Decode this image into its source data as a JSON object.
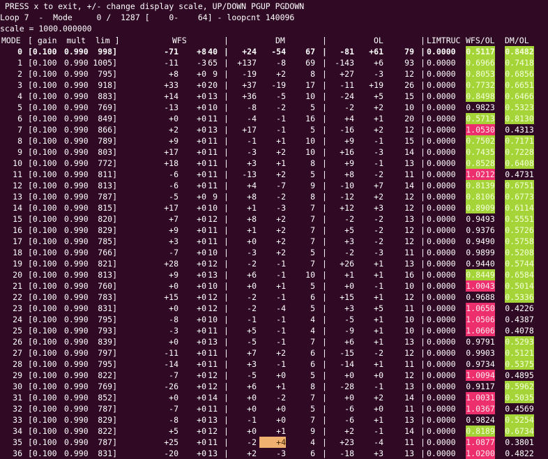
{
  "header": {
    "instructions": " PRESS x to exit, +/- change display scale, UP/DOWN PGUP PGDOWN",
    "status": "Loop 7  -  Mode     0 /  1287 [    0-    64] - loopcnt 140096",
    "scale": "scale = 1000.000000"
  },
  "columns": {
    "mode": "MODE",
    "gain_group": "[ gain  mult  lim ]",
    "wfs": "WFS",
    "dm": "DM",
    "ol": "OL",
    "limtruc": "LIMTRUC",
    "wfs_ol": "WFS/OL",
    "dm_ol": "DM/OL",
    "sep": "|"
  },
  "colors": {
    "background": "#300a24",
    "good": "#a4d438",
    "bad": "#ee2f6e",
    "warn": "#f0b070"
  },
  "rows": [
    {
      "mode": "0",
      "gain": "[0.100",
      "mult": "0.990",
      "lim": "998]",
      "wfs": [
        "-71",
        "+8",
        "40"
      ],
      "dm": [
        "+24",
        "-54",
        "67"
      ],
      "ol": [
        "-81",
        "+61",
        "79"
      ],
      "limtruc": "0.0000",
      "wfs_ol": "0.5117",
      "dm_ol": "0.8482",
      "wfs_hl": "g",
      "dm_hl": "g",
      "bold": true
    },
    {
      "mode": "1",
      "gain": "[0.100",
      "mult": "0.990",
      "lim": "1005]",
      "wfs": [
        "-11",
        "-3",
        "65"
      ],
      "dm": [
        "+137",
        "-8",
        "69"
      ],
      "ol": [
        "-143",
        "+6",
        "93"
      ],
      "limtruc": "0.0000",
      "wfs_ol": "0.6966",
      "dm_ol": "0.7418",
      "wfs_hl": "g",
      "dm_hl": "g"
    },
    {
      "mode": "2",
      "gain": "[0.100",
      "mult": "0.990",
      "lim": "795]",
      "wfs": [
        "+8",
        "+0",
        "9"
      ],
      "dm": [
        "-19",
        "+2",
        "8"
      ],
      "ol": [
        "+27",
        "-3",
        "12"
      ],
      "limtruc": "0.0000",
      "wfs_ol": "0.8053",
      "dm_ol": "0.6856",
      "wfs_hl": "g",
      "dm_hl": "g"
    },
    {
      "mode": "3",
      "gain": "[0.100",
      "mult": "0.990",
      "lim": "918]",
      "wfs": [
        "+33",
        "+0",
        "20"
      ],
      "dm": [
        "+37",
        "-19",
        "17"
      ],
      "ol": [
        "-11",
        "+19",
        "26"
      ],
      "limtruc": "0.0000",
      "wfs_ol": "0.7732",
      "dm_ol": "0.6651",
      "wfs_hl": "g",
      "dm_hl": "g"
    },
    {
      "mode": "4",
      "gain": "[0.100",
      "mult": "0.990",
      "lim": "883]",
      "wfs": [
        "+14",
        "+0",
        "13"
      ],
      "dm": [
        "+36",
        "-5",
        "10"
      ],
      "ol": [
        "-24",
        "+5",
        "15"
      ],
      "limtruc": "0.0000",
      "wfs_ol": "0.8498",
      "dm_ol": "0.6466",
      "wfs_hl": "g",
      "dm_hl": "g"
    },
    {
      "mode": "5",
      "gain": "[0.100",
      "mult": "0.990",
      "lim": "769]",
      "wfs": [
        "-13",
        "+0",
        "10"
      ],
      "dm": [
        "-8",
        "-2",
        "5"
      ],
      "ol": [
        "-2",
        "+2",
        "10"
      ],
      "limtruc": "0.0000",
      "wfs_ol": "0.9823",
      "dm_ol": "0.5323",
      "wfs_hl": "",
      "dm_hl": "g"
    },
    {
      "mode": "6",
      "gain": "[0.100",
      "mult": "0.990",
      "lim": "849]",
      "wfs": [
        "+0",
        "+0",
        "11"
      ],
      "dm": [
        "-4",
        "-1",
        "16"
      ],
      "ol": [
        "+4",
        "+1",
        "20"
      ],
      "limtruc": "0.0000",
      "wfs_ol": "0.5713",
      "dm_ol": "0.8130",
      "wfs_hl": "g",
      "dm_hl": "g"
    },
    {
      "mode": "7",
      "gain": "[0.100",
      "mult": "0.990",
      "lim": "866]",
      "wfs": [
        "+2",
        "+0",
        "13"
      ],
      "dm": [
        "+17",
        "-1",
        "5"
      ],
      "ol": [
        "-16",
        "+2",
        "12"
      ],
      "limtruc": "0.0000",
      "wfs_ol": "1.0530",
      "dm_ol": "0.4313",
      "wfs_hl": "p",
      "dm_hl": ""
    },
    {
      "mode": "8",
      "gain": "[0.100",
      "mult": "0.990",
      "lim": "789]",
      "wfs": [
        "+9",
        "+0",
        "11"
      ],
      "dm": [
        "-1",
        "+1",
        "10"
      ],
      "ol": [
        "+9",
        "-1",
        "15"
      ],
      "limtruc": "0.0000",
      "wfs_ol": "0.7502",
      "dm_ol": "0.7171",
      "wfs_hl": "g",
      "dm_hl": "g"
    },
    {
      "mode": "9",
      "gain": "[0.100",
      "mult": "0.990",
      "lim": "803]",
      "wfs": [
        "+17",
        "+0",
        "11"
      ],
      "dm": [
        "-3",
        "+2",
        "10"
      ],
      "ol": [
        "+16",
        "-3",
        "14"
      ],
      "limtruc": "0.0000",
      "wfs_ol": "0.7435",
      "dm_ol": "0.7228",
      "wfs_hl": "g",
      "dm_hl": "g"
    },
    {
      "mode": "10",
      "gain": "[0.100",
      "mult": "0.990",
      "lim": "772]",
      "wfs": [
        "+18",
        "+0",
        "11"
      ],
      "dm": [
        "+3",
        "+1",
        "8"
      ],
      "ol": [
        "+9",
        "-1",
        "13"
      ],
      "limtruc": "0.0000",
      "wfs_ol": "0.8528",
      "dm_ol": "0.6408",
      "wfs_hl": "g",
      "dm_hl": "g"
    },
    {
      "mode": "11",
      "gain": "[0.100",
      "mult": "0.990",
      "lim": "811]",
      "wfs": [
        "-6",
        "+0",
        "11"
      ],
      "dm": [
        "-13",
        "+2",
        "5"
      ],
      "ol": [
        "+8",
        "-2",
        "11"
      ],
      "limtruc": "0.0000",
      "wfs_ol": "1.0212",
      "dm_ol": "0.4731",
      "wfs_hl": "p",
      "dm_hl": ""
    },
    {
      "mode": "12",
      "gain": "[0.100",
      "mult": "0.990",
      "lim": "813]",
      "wfs": [
        "-6",
        "+0",
        "11"
      ],
      "dm": [
        "+4",
        "-7",
        "9"
      ],
      "ol": [
        "-10",
        "+7",
        "14"
      ],
      "limtruc": "0.0000",
      "wfs_ol": "0.8139",
      "dm_ol": "0.6751",
      "wfs_hl": "g",
      "dm_hl": "g"
    },
    {
      "mode": "13",
      "gain": "[0.100",
      "mult": "0.990",
      "lim": "787]",
      "wfs": [
        "-5",
        "+0",
        "9"
      ],
      "dm": [
        "+8",
        "-2",
        "8"
      ],
      "ol": [
        "-12",
        "+2",
        "12"
      ],
      "limtruc": "0.0000",
      "wfs_ol": "0.8106",
      "dm_ol": "0.6773",
      "wfs_hl": "g",
      "dm_hl": "g"
    },
    {
      "mode": "14",
      "gain": "[0.100",
      "mult": "0.990",
      "lim": "815]",
      "wfs": [
        "+17",
        "+0",
        "10"
      ],
      "dm": [
        "+1",
        "-3",
        "7"
      ],
      "ol": [
        "+12",
        "+3",
        "12"
      ],
      "limtruc": "0.0000",
      "wfs_ol": "0.8909",
      "dm_ol": "0.6114",
      "wfs_hl": "g",
      "dm_hl": "g"
    },
    {
      "mode": "15",
      "gain": "[0.100",
      "mult": "0.990",
      "lim": "820]",
      "wfs": [
        "+7",
        "+0",
        "12"
      ],
      "dm": [
        "+8",
        "+2",
        "7"
      ],
      "ol": [
        "-2",
        "-2",
        "13"
      ],
      "limtruc": "0.0000",
      "wfs_ol": "0.9493",
      "dm_ol": "0.5551",
      "wfs_hl": "",
      "dm_hl": "g"
    },
    {
      "mode": "16",
      "gain": "[0.100",
      "mult": "0.990",
      "lim": "829]",
      "wfs": [
        "+9",
        "+0",
        "11"
      ],
      "dm": [
        "+1",
        "+2",
        "7"
      ],
      "ol": [
        "+5",
        "-2",
        "12"
      ],
      "limtruc": "0.0000",
      "wfs_ol": "0.9376",
      "dm_ol": "0.5726",
      "wfs_hl": "",
      "dm_hl": "g"
    },
    {
      "mode": "17",
      "gain": "[0.100",
      "mult": "0.990",
      "lim": "785]",
      "wfs": [
        "+3",
        "+0",
        "11"
      ],
      "dm": [
        "+0",
        "+2",
        "7"
      ],
      "ol": [
        "+3",
        "-2",
        "12"
      ],
      "limtruc": "0.0000",
      "wfs_ol": "0.9490",
      "dm_ol": "0.5758",
      "wfs_hl": "",
      "dm_hl": "g"
    },
    {
      "mode": "18",
      "gain": "[0.100",
      "mult": "0.990",
      "lim": "766]",
      "wfs": [
        "-7",
        "+0",
        "10"
      ],
      "dm": [
        "-3",
        "+2",
        "5"
      ],
      "ol": [
        "-2",
        "-3",
        "11"
      ],
      "limtruc": "0.0000",
      "wfs_ol": "0.9899",
      "dm_ol": "0.5208",
      "wfs_hl": "",
      "dm_hl": "g"
    },
    {
      "mode": "19",
      "gain": "[0.100",
      "mult": "0.990",
      "lim": "821]",
      "wfs": [
        "+28",
        "+0",
        "12"
      ],
      "dm": [
        "-2",
        "-1",
        "7"
      ],
      "ol": [
        "+26",
        "+1",
        "13"
      ],
      "limtruc": "0.0000",
      "wfs_ol": "0.9440",
      "dm_ol": "0.5744",
      "wfs_hl": "",
      "dm_hl": "g"
    },
    {
      "mode": "20",
      "gain": "[0.100",
      "mult": "0.990",
      "lim": "813]",
      "wfs": [
        "+9",
        "+0",
        "13"
      ],
      "dm": [
        "+6",
        "-1",
        "10"
      ],
      "ol": [
        "+1",
        "+1",
        "16"
      ],
      "limtruc": "0.0000",
      "wfs_ol": "0.8449",
      "dm_ol": "0.6584",
      "wfs_hl": "g",
      "dm_hl": "g"
    },
    {
      "mode": "21",
      "gain": "[0.100",
      "mult": "0.990",
      "lim": "760]",
      "wfs": [
        "+0",
        "+0",
        "10"
      ],
      "dm": [
        "+0",
        "+1",
        "5"
      ],
      "ol": [
        "+0",
        "-1",
        "10"
      ],
      "limtruc": "0.0000",
      "wfs_ol": "1.0043",
      "dm_ol": "0.5014",
      "wfs_hl": "p",
      "dm_hl": "g"
    },
    {
      "mode": "22",
      "gain": "[0.100",
      "mult": "0.990",
      "lim": "783]",
      "wfs": [
        "+15",
        "+0",
        "12"
      ],
      "dm": [
        "-2",
        "-1",
        "6"
      ],
      "ol": [
        "+15",
        "+1",
        "12"
      ],
      "limtruc": "0.0000",
      "wfs_ol": "0.9688",
      "dm_ol": "0.5336",
      "wfs_hl": "",
      "dm_hl": "g"
    },
    {
      "mode": "23",
      "gain": "[0.100",
      "mult": "0.990",
      "lim": "831]",
      "wfs": [
        "+0",
        "+0",
        "12"
      ],
      "dm": [
        "-2",
        "-4",
        "5"
      ],
      "ol": [
        "+3",
        "+5",
        "11"
      ],
      "limtruc": "0.0000",
      "wfs_ol": "1.0650",
      "dm_ol": "0.4226",
      "wfs_hl": "p",
      "dm_hl": ""
    },
    {
      "mode": "24",
      "gain": "[0.100",
      "mult": "0.990",
      "lim": "795]",
      "wfs": [
        "-8",
        "+0",
        "10"
      ],
      "dm": [
        "-1",
        "-1",
        "4"
      ],
      "ol": [
        "-5",
        "+1",
        "10"
      ],
      "limtruc": "0.0000",
      "wfs_ol": "1.0506",
      "dm_ol": "0.4387",
      "wfs_hl": "p",
      "dm_hl": ""
    },
    {
      "mode": "25",
      "gain": "[0.100",
      "mult": "0.990",
      "lim": "793]",
      "wfs": [
        "-3",
        "+0",
        "11"
      ],
      "dm": [
        "+5",
        "-1",
        "4"
      ],
      "ol": [
        "-9",
        "+1",
        "10"
      ],
      "limtruc": "0.0000",
      "wfs_ol": "1.0606",
      "dm_ol": "0.4078",
      "wfs_hl": "p",
      "dm_hl": ""
    },
    {
      "mode": "26",
      "gain": "[0.100",
      "mult": "0.990",
      "lim": "839]",
      "wfs": [
        "+0",
        "+0",
        "13"
      ],
      "dm": [
        "-5",
        "-1",
        "7"
      ],
      "ol": [
        "+6",
        "+1",
        "13"
      ],
      "limtruc": "0.0000",
      "wfs_ol": "0.9791",
      "dm_ol": "0.5293",
      "wfs_hl": "",
      "dm_hl": "g"
    },
    {
      "mode": "27",
      "gain": "[0.100",
      "mult": "0.990",
      "lim": "797]",
      "wfs": [
        "-11",
        "+0",
        "11"
      ],
      "dm": [
        "+7",
        "+2",
        "6"
      ],
      "ol": [
        "-15",
        "-2",
        "12"
      ],
      "limtruc": "0.0000",
      "wfs_ol": "0.9903",
      "dm_ol": "0.5121",
      "wfs_hl": "",
      "dm_hl": "g"
    },
    {
      "mode": "28",
      "gain": "[0.100",
      "mult": "0.990",
      "lim": "795]",
      "wfs": [
        "-14",
        "+0",
        "11"
      ],
      "dm": [
        "+3",
        "-1",
        "6"
      ],
      "ol": [
        "-14",
        "+1",
        "11"
      ],
      "limtruc": "0.0000",
      "wfs_ol": "0.9734",
      "dm_ol": "0.5375",
      "wfs_hl": "",
      "dm_hl": "g"
    },
    {
      "mode": "29",
      "gain": "[0.100",
      "mult": "0.990",
      "lim": "822]",
      "wfs": [
        "-7",
        "+0",
        "12"
      ],
      "dm": [
        "-5",
        "+0",
        "5"
      ],
      "ol": [
        "+0",
        "+0",
        "12"
      ],
      "limtruc": "0.0000",
      "wfs_ol": "1.0094",
      "dm_ol": "0.4895",
      "wfs_hl": "p",
      "dm_hl": ""
    },
    {
      "mode": "30",
      "gain": "[0.100",
      "mult": "0.990",
      "lim": "769]",
      "wfs": [
        "-26",
        "+0",
        "12"
      ],
      "dm": [
        "+6",
        "+1",
        "8"
      ],
      "ol": [
        "-28",
        "-1",
        "13"
      ],
      "limtruc": "0.0000",
      "wfs_ol": "0.9117",
      "dm_ol": "0.5962",
      "wfs_hl": "",
      "dm_hl": "g"
    },
    {
      "mode": "31",
      "gain": "[0.100",
      "mult": "0.990",
      "lim": "852]",
      "wfs": [
        "+0",
        "+0",
        "14"
      ],
      "dm": [
        "+0",
        "-2",
        "7"
      ],
      "ol": [
        "+0",
        "+2",
        "14"
      ],
      "limtruc": "0.0000",
      "wfs_ol": "1.0031",
      "dm_ol": "0.5035",
      "wfs_hl": "p",
      "dm_hl": "g"
    },
    {
      "mode": "32",
      "gain": "[0.100",
      "mult": "0.990",
      "lim": "787]",
      "wfs": [
        "-7",
        "+0",
        "11"
      ],
      "dm": [
        "+0",
        "+0",
        "5"
      ],
      "ol": [
        "-6",
        "+0",
        "11"
      ],
      "limtruc": "0.0000",
      "wfs_ol": "1.0367",
      "dm_ol": "0.4569",
      "wfs_hl": "p",
      "dm_hl": ""
    },
    {
      "mode": "33",
      "gain": "[0.100",
      "mult": "0.990",
      "lim": "829]",
      "wfs": [
        "-8",
        "+0",
        "13"
      ],
      "dm": [
        "-1",
        "+0",
        "7"
      ],
      "ol": [
        "-6",
        "+1",
        "13"
      ],
      "limtruc": "0.0000",
      "wfs_ol": "0.9824",
      "dm_ol": "0.5254",
      "wfs_hl": "",
      "dm_hl": "g"
    },
    {
      "mode": "34",
      "gain": "[0.100",
      "mult": "0.990",
      "lim": "822]",
      "wfs": [
        "+5",
        "+0",
        "12"
      ],
      "dm": [
        "+0",
        "+1",
        "9"
      ],
      "ol": [
        "+2",
        "-1",
        "14"
      ],
      "limtruc": "0.0000",
      "wfs_ol": "0.8189",
      "dm_ol": "0.6734",
      "wfs_hl": "g",
      "dm_hl": "g"
    },
    {
      "mode": "35",
      "gain": "[0.100",
      "mult": "0.990",
      "lim": "787]",
      "wfs": [
        "+25",
        "+0",
        "11"
      ],
      "dm": [
        "-2",
        "+4",
        "4"
      ],
      "ol": [
        "+23",
        "-4",
        "11"
      ],
      "limtruc": "0.0000",
      "wfs_ol": "1.0877",
      "dm_ol": "0.3801",
      "wfs_hl": "p",
      "dm_hl": "",
      "dm2_hl": "o"
    },
    {
      "mode": "36",
      "gain": "[0.100",
      "mult": "0.990",
      "lim": "831]",
      "wfs": [
        "-20",
        "+0",
        "13"
      ],
      "dm": [
        "+2",
        "-3",
        "6"
      ],
      "ol": [
        "-18",
        "+3",
        "13"
      ],
      "limtruc": "0.0000",
      "wfs_ol": "1.0200",
      "dm_ol": "0.4822",
      "wfs_hl": "p",
      "dm_hl": ""
    }
  ]
}
